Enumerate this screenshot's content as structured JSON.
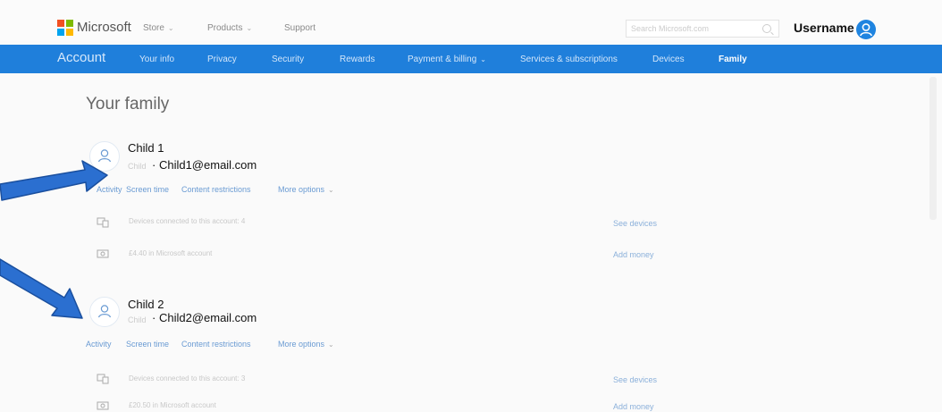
{
  "header": {
    "logo_text": "Microsoft",
    "nav": [
      {
        "label": "Store",
        "dropdown": true
      },
      {
        "label": "Products",
        "dropdown": true
      },
      {
        "label": "Support",
        "dropdown": false
      }
    ],
    "search_placeholder": "Search Microsoft.com",
    "username": "Username"
  },
  "account_nav": {
    "title": "Account",
    "tabs": [
      {
        "label": "Your info"
      },
      {
        "label": "Privacy"
      },
      {
        "label": "Security"
      },
      {
        "label": "Rewards"
      },
      {
        "label": "Payment & billing"
      },
      {
        "label": "Services & subscriptions"
      },
      {
        "label": "Devices"
      },
      {
        "label": "Family"
      }
    ]
  },
  "page": {
    "title": "Your family"
  },
  "children": [
    {
      "name": "Child 1",
      "role": "Child",
      "email": "Child1@email.com",
      "actions": [
        "Activity",
        "Screen time",
        "Content restrictions",
        "More options"
      ],
      "devices_text": "Devices connected to this account: 4",
      "devices_link": "See devices",
      "money_text": "£4.40 in Microsoft account",
      "money_link": "Add money"
    },
    {
      "name": "Child 2",
      "role": "Child",
      "email": "Child2@email.com",
      "actions": [
        "Activity",
        "Screen time",
        "Content restrictions",
        "More options"
      ],
      "devices_text": "Devices connected to this account: 3",
      "devices_link": "See devices",
      "money_text": "£20.50 in Microsoft account",
      "money_link": "Add money"
    }
  ],
  "colors": {
    "accent": "#1f7fdb",
    "link": "#6a9bd3",
    "arrow": "#2b6fd0"
  }
}
